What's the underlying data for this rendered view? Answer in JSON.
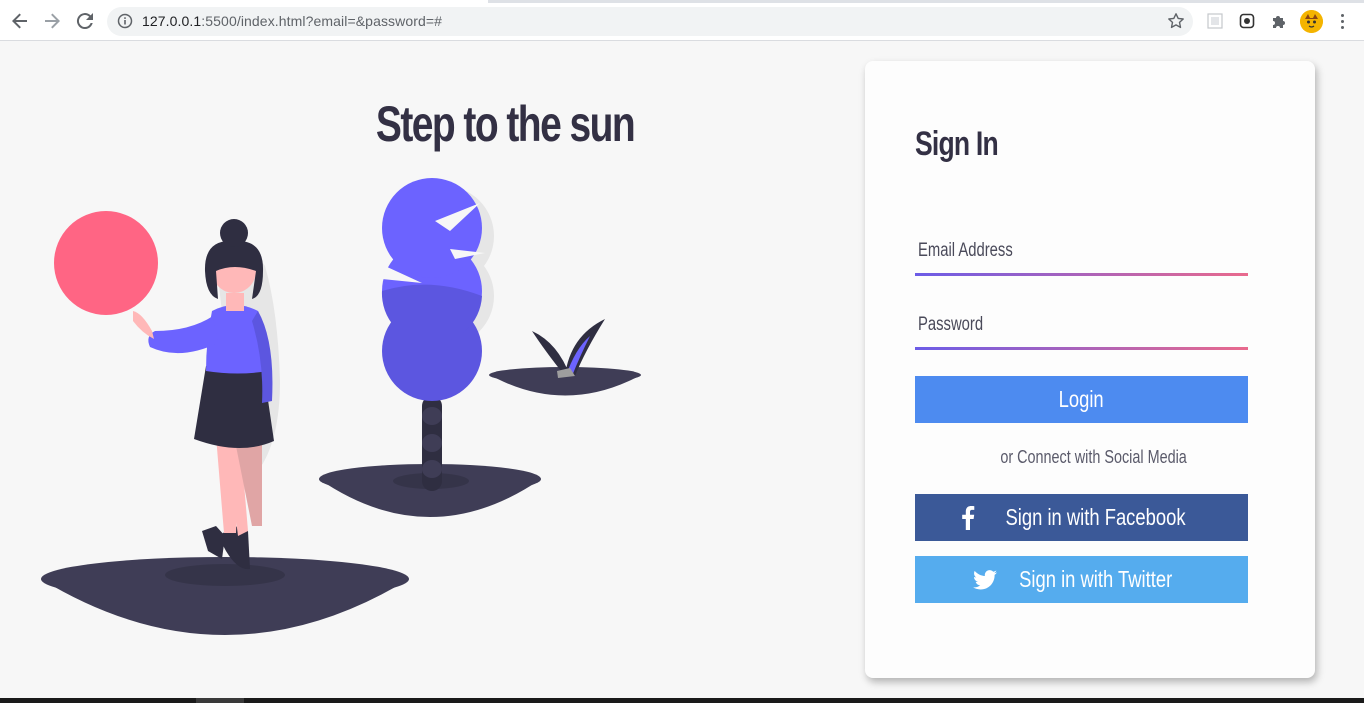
{
  "browser": {
    "url_host": "127.0.0.1",
    "url_rest": ":5500/index.html?email=&password=#"
  },
  "hero": {
    "title": "Step to the sun"
  },
  "signin": {
    "title": "Sign In",
    "email_placeholder": "Email Address",
    "password_placeholder": "Password",
    "login_label": "Login",
    "social_text": "or Connect with Social Media",
    "facebook_label": "Sign in with Facebook",
    "twitter_label": "Sign in with Twitter"
  },
  "colors": {
    "accent_login": "#4d8bf0",
    "facebook": "#3b5998",
    "twitter": "#55acee",
    "illustration_purple": "#6c63ff",
    "illustration_pink": "#ff6584",
    "text_dark": "#333044"
  },
  "icons": [
    "back-arrow-icon",
    "forward-arrow-icon",
    "reload-icon",
    "info-icon",
    "bookmark-star-icon",
    "extension-icon",
    "puzzle-icon",
    "profile-avatar",
    "menu-kebab-icon",
    "facebook-icon",
    "twitter-icon"
  ]
}
